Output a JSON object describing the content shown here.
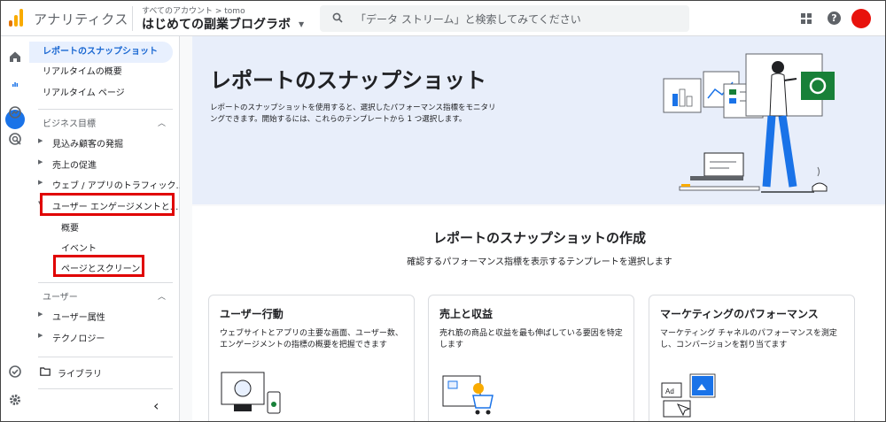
{
  "header": {
    "app_title": "アナリティクス",
    "account_crumb": "すべてのアカウント > tomo",
    "account_name": "はじめての副業ブログラボ",
    "search_placeholder": "「データ ストリーム」と検索してみてください"
  },
  "sidebar": {
    "top_items": [
      {
        "label": "レポートのスナップショット"
      },
      {
        "label": "リアルタイムの概要"
      },
      {
        "label": "リアルタイム ページ"
      }
    ],
    "section_business": "ビジネス目標",
    "business_items": [
      {
        "label": "見込み顧客の発掘"
      },
      {
        "label": "売上の促進"
      },
      {
        "label": "ウェブ / アプリのトラフィック..."
      },
      {
        "label": "ユーザー エンゲージメントと..."
      }
    ],
    "engagement_children": [
      {
        "label": "概要"
      },
      {
        "label": "イベント"
      },
      {
        "label": "ページとスクリーン"
      }
    ],
    "section_user": "ユーザー",
    "user_items": [
      {
        "label": "ユーザー属性"
      },
      {
        "label": "テクノロジー"
      }
    ],
    "library_label": "ライブラリ"
  },
  "hero": {
    "title": "レポートのスナップショット",
    "description": "レポートのスナップショットを使用すると、選択したパフォーマンス指標をモニタリングできます。開始するには、これらのテンプレートから 1 つ選択します。"
  },
  "create": {
    "title": "レポートのスナップショットの作成",
    "subtitle": "確認するパフォーマンス指標を表示するテンプレートを選択します"
  },
  "cards": [
    {
      "title": "ユーザー行動",
      "description": "ウェブサイトとアプリの主要な画面、ユーザー数、エンゲージメントの指標の概要を把握できます"
    },
    {
      "title": "売上と収益",
      "description": "売れ筋の商品と収益を最も伸ばしている要因を特定します"
    },
    {
      "title": "マーケティングのパフォーマンス",
      "description": "マーケティング チャネルのパフォーマンスを測定し、コンバージョンを割り当てます"
    }
  ],
  "card_art_label": "Ad",
  "colors": {
    "accent": "#1a73e8",
    "active_bg": "#e8f0fe",
    "highlight_box": "#e00000",
    "hero_bg": "#e8eefa",
    "logo_orange": "#f9ab00",
    "logo_dark_orange": "#e37400"
  }
}
